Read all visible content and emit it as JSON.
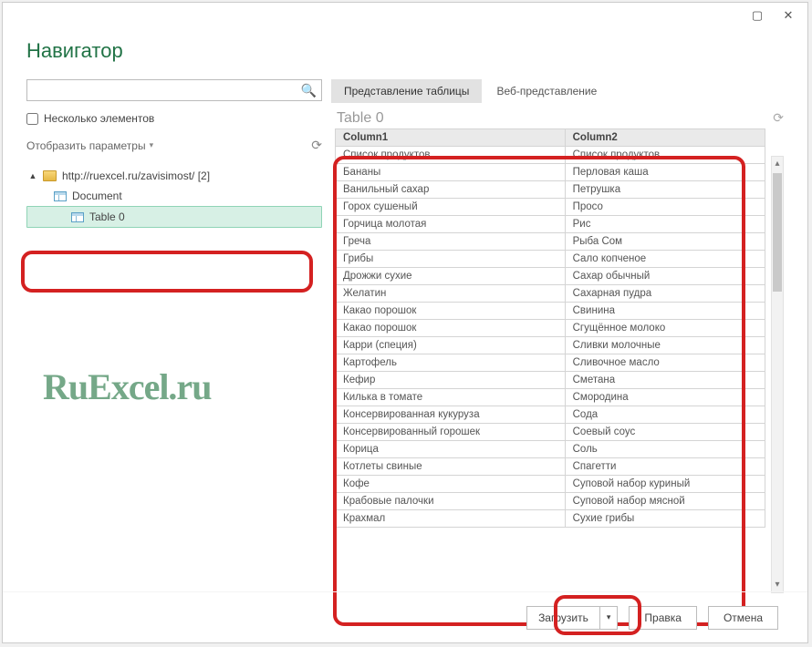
{
  "title": "Навигатор",
  "search": {
    "placeholder": ""
  },
  "multi_label": "Несколько элементов",
  "params_label": "Отобразить параметры",
  "tree": {
    "root": "http://ruexcel.ru/zavisimost/ [2]",
    "items": [
      "Document",
      "Table 0"
    ]
  },
  "tabs": {
    "table": "Представление таблицы",
    "web": "Веб-представление"
  },
  "preview_title": "Table 0",
  "columns": [
    "Column1",
    "Column2"
  ],
  "rows": [
    [
      "Список продуктов.",
      "Список продуктов."
    ],
    [
      "Бананы",
      "Перловая каша"
    ],
    [
      "Ванильный сахар",
      "Петрушка"
    ],
    [
      "Горох сушеный",
      "Просо"
    ],
    [
      "Горчица молотая",
      "Рис"
    ],
    [
      "Греча",
      "Рыба Сом"
    ],
    [
      "Грибы",
      "Сало копченое"
    ],
    [
      "Дрожжи сухие",
      "Сахар обычный"
    ],
    [
      "Желатин",
      "Сахарная пудра"
    ],
    [
      "Какао порошок",
      "Свинина"
    ],
    [
      "Какао порошок",
      "Сгущённое молоко"
    ],
    [
      "Карри (специя)",
      "Сливки молочные"
    ],
    [
      "Картофель",
      "Сливочное масло"
    ],
    [
      "Кефир",
      "Сметана"
    ],
    [
      "Килька в томате",
      "Смородина"
    ],
    [
      "Консервированная кукуруза",
      "Сода"
    ],
    [
      "Консервированный горошек",
      "Соевый соус"
    ],
    [
      "Корица",
      "Соль"
    ],
    [
      "Котлеты свиные",
      "Спагетти"
    ],
    [
      "Кофе",
      "Суповой набор куриный"
    ],
    [
      "Крабовые палочки",
      "Суповой набор мясной"
    ],
    [
      "Крахмал",
      "Сухие грибы"
    ]
  ],
  "buttons": {
    "load": "Загрузить",
    "edit": "Правка",
    "cancel": "Отмена"
  },
  "watermark": "RuExcel.ru"
}
